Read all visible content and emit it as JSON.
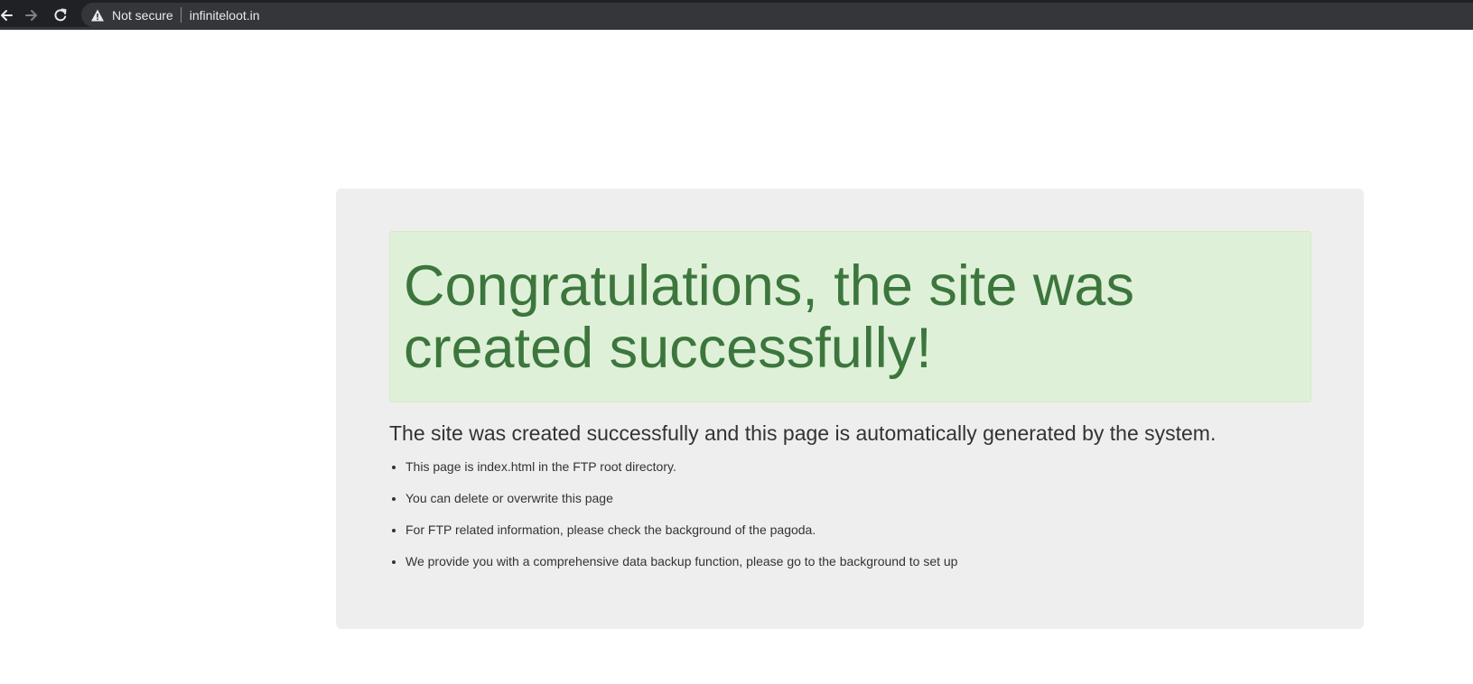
{
  "browser": {
    "back_icon": "arrow-left-icon",
    "forward_icon": "arrow-right-icon",
    "reload_icon": "reload-icon",
    "security_icon": "warning-triangle-icon",
    "security_label": "Not secure",
    "url": "infiniteloot.in"
  },
  "page": {
    "headline": "Congratulations, the site was created successfully!",
    "subtitle": "The site was created successfully and this page is automatically generated by the system.",
    "items": [
      "This page is index.html in the FTP root directory.",
      "You can delete or overwrite this page",
      "For FTP related information, please check the background of the pagoda.",
      "We provide you with a comprehensive data backup function, please go to the background to set up"
    ]
  },
  "colors": {
    "toolbar_bg": "#202124",
    "omnibox_bg": "#35363a",
    "panel_bg": "#eeeeee",
    "alert_bg": "#dff0d8",
    "alert_text": "#3c763d",
    "body_text": "#333333"
  }
}
